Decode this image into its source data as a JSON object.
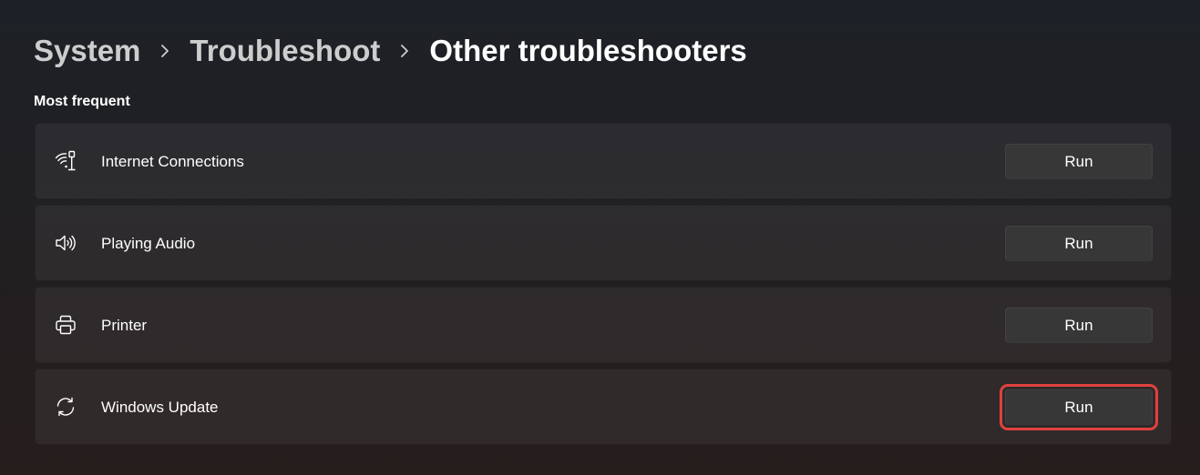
{
  "breadcrumb": {
    "items": [
      "System",
      "Troubleshoot"
    ],
    "current": "Other troubleshooters"
  },
  "section": {
    "title": "Most frequent"
  },
  "troubleshooters": [
    {
      "label": "Internet Connections",
      "icon": "wifi-icon",
      "button": "Run"
    },
    {
      "label": "Playing Audio",
      "icon": "speaker-icon",
      "button": "Run"
    },
    {
      "label": "Printer",
      "icon": "printer-icon",
      "button": "Run"
    },
    {
      "label": "Windows Update",
      "icon": "sync-icon",
      "button": "Run",
      "highlighted": true
    }
  ],
  "colors": {
    "highlight": "#e04140",
    "button": "#373737"
  }
}
